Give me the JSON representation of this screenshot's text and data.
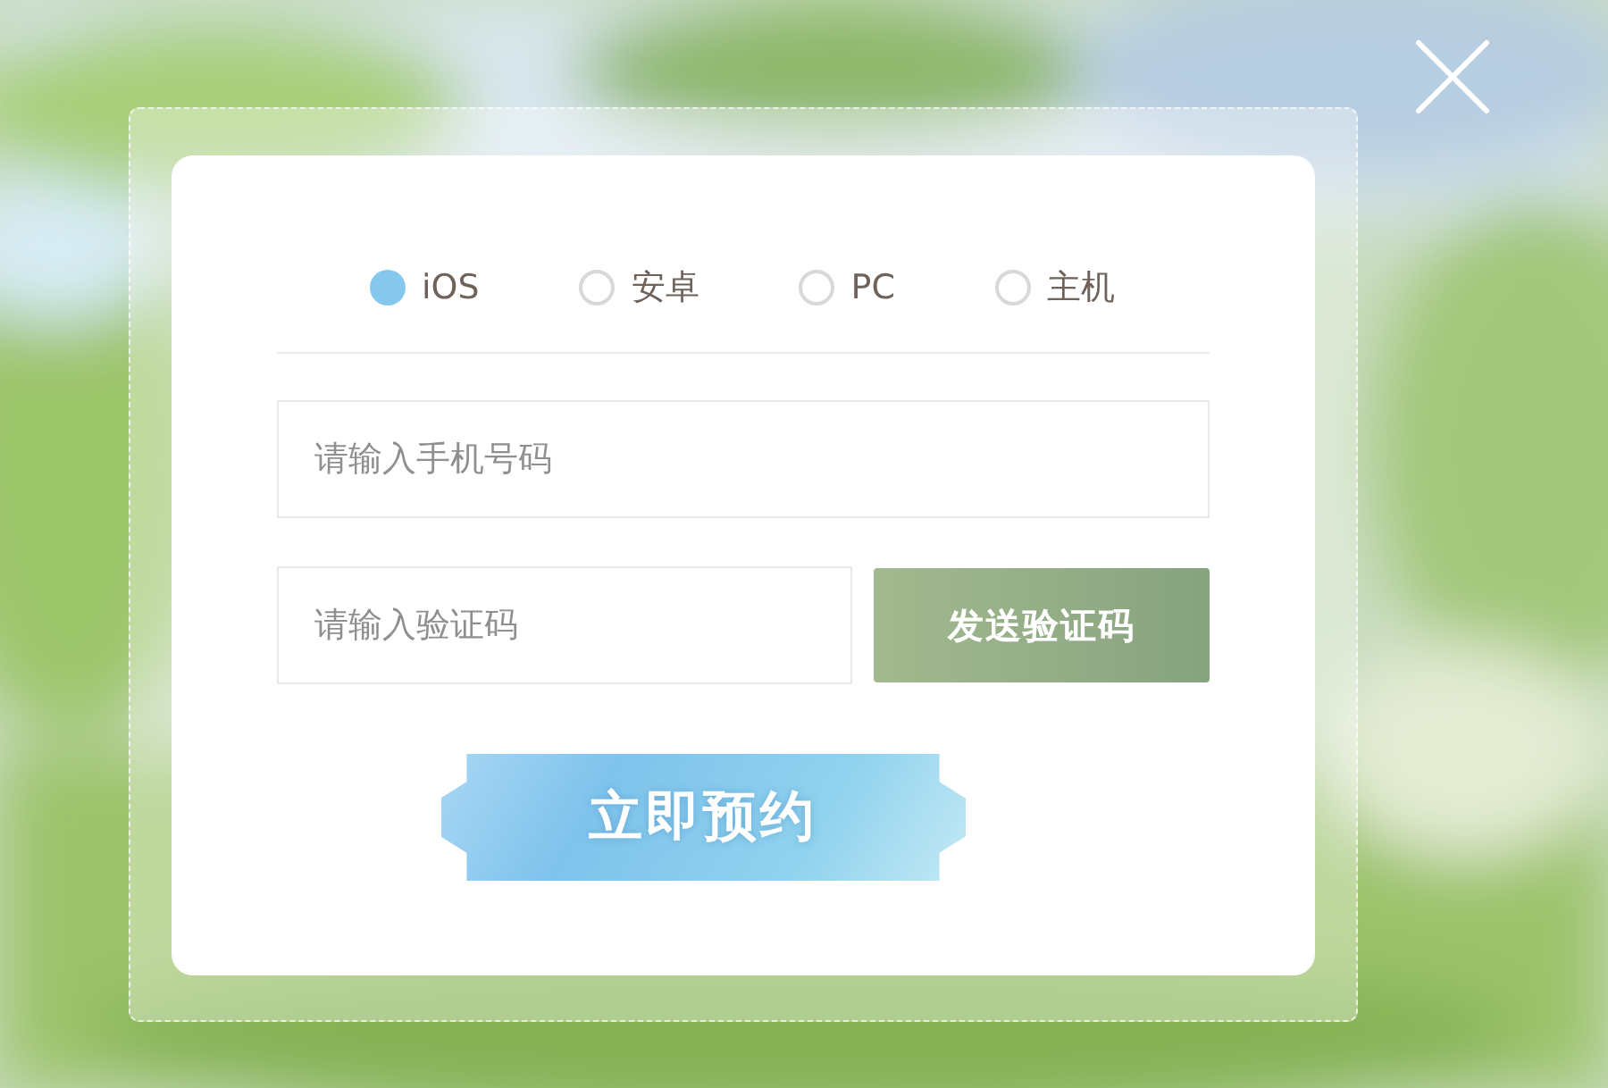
{
  "platforms": [
    {
      "label": "iOS",
      "selected": true
    },
    {
      "label": "安卓",
      "selected": false
    },
    {
      "label": "PC",
      "selected": false
    },
    {
      "label": "主机",
      "selected": false
    }
  ],
  "phone_field": {
    "placeholder": "请输入手机号码"
  },
  "code_field": {
    "placeholder": "请输入验证码"
  },
  "send_code_button": "发送验证码",
  "submit_button": "立即预约"
}
